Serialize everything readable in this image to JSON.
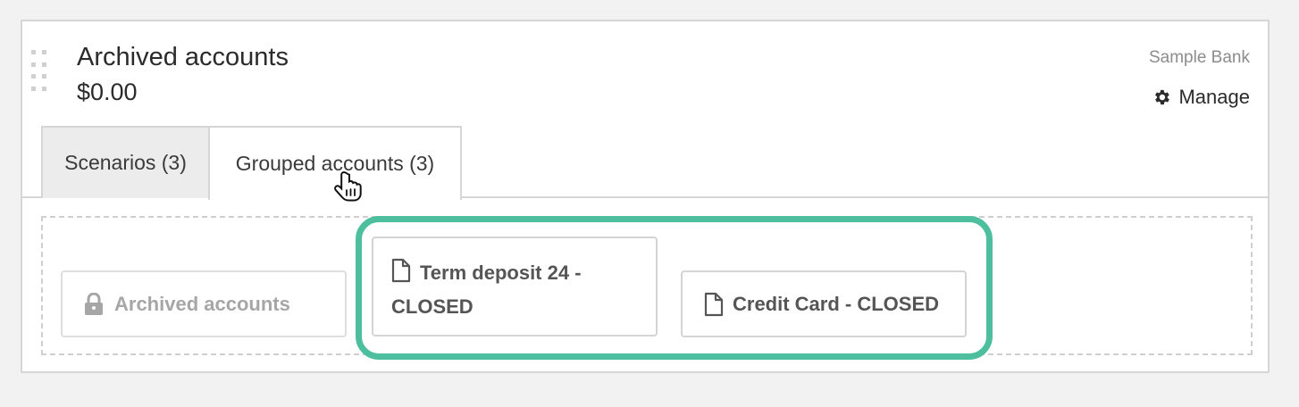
{
  "panel": {
    "title": "Archived accounts",
    "amount": "$0.00",
    "bank_name": "Sample Bank",
    "manage_label": "Manage"
  },
  "tabs": [
    {
      "label": "Scenarios (3)",
      "active": false
    },
    {
      "label": "Grouped accounts (3)",
      "active": true
    }
  ],
  "cards": {
    "archived": {
      "label": "Archived accounts",
      "icon": "lock-icon",
      "locked": true
    },
    "term_deposit": {
      "label_line1": "Term deposit 24 -",
      "label_line2": "CLOSED",
      "icon": "document-icon"
    },
    "credit_card": {
      "label": "Credit Card - CLOSED",
      "icon": "document-icon"
    }
  },
  "colors": {
    "highlight": "#4dbf9f",
    "border": "#d6d6d6",
    "muted_text": "#a6a6a6"
  }
}
